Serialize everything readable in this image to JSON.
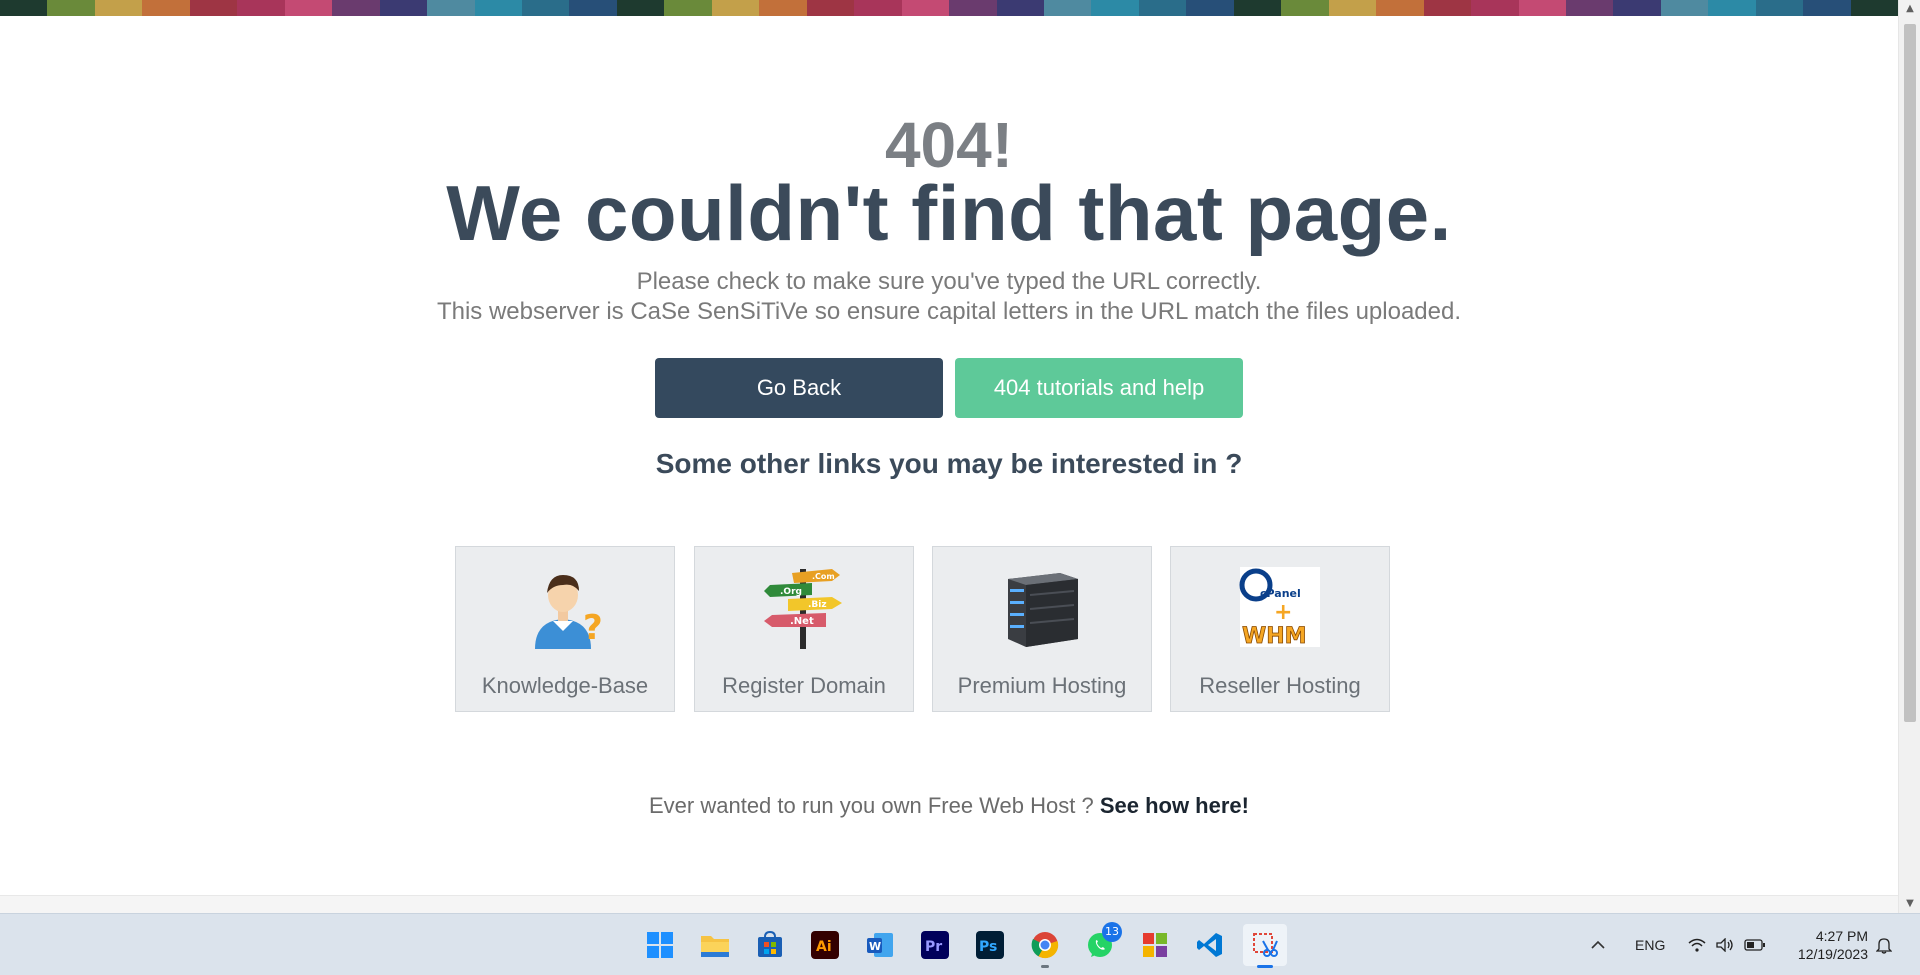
{
  "strip_colors": [
    "#1e3a2f",
    "#6a8a3a",
    "#c3a04a",
    "#c2703a",
    "#9e3544",
    "#a8355a",
    "#c44a73",
    "#6a3b6e",
    "#3b3a72",
    "#4f8aa0",
    "#2c8aa6",
    "#2a6d8a",
    "#274f78",
    "#1e3a2f",
    "#6a8a3a",
    "#c3a04a",
    "#c2703a",
    "#9e3544",
    "#a8355a",
    "#c44a73",
    "#6a3b6e",
    "#3b3a72",
    "#4f8aa0",
    "#2c8aa6",
    "#2a6d8a",
    "#274f78",
    "#1e3a2f",
    "#6a8a3a",
    "#c3a04a",
    "#c2703a",
    "#9e3544",
    "#a8355a",
    "#c44a73",
    "#6a3b6e",
    "#3b3a72",
    "#4f8aa0",
    "#2c8aa6",
    "#2a6d8a",
    "#274f78",
    "#1e3a2f"
  ],
  "error": {
    "code": "404!",
    "headline": "We couldn't find that page.",
    "line1": "Please check to make sure you've typed the URL correctly.",
    "line2": "This webserver is CaSe SenSiTiVe so ensure capital letters in the URL match the files uploaded."
  },
  "buttons": {
    "back": "Go Back",
    "help": "404 tutorials and help"
  },
  "other_links_heading": "Some other links you may be interested in ?",
  "cards": [
    {
      "label": "Knowledge-Base",
      "icon": "knowledge-base-icon"
    },
    {
      "label": "Register Domain",
      "icon": "domain-signpost-icon"
    },
    {
      "label": "Premium Hosting",
      "icon": "server-icon"
    },
    {
      "label": "Reseller Hosting",
      "icon": "cpanel-whm-icon"
    }
  ],
  "cpanel_logo_text": {
    "top": "cPanel",
    "bottom": "WHM"
  },
  "domain_signs": [
    ".Com",
    ".Org",
    ".Biz",
    ".Net"
  ],
  "footer": {
    "prefix": "Ever wanted to run you own Free Web Host ? ",
    "link": "See how here!"
  },
  "taskbar": {
    "apps": [
      "start-icon",
      "file-explorer-icon",
      "store-icon",
      "illustrator-icon",
      "word-icon",
      "premiere-icon",
      "photoshop-icon",
      "chrome-icon",
      "whatsapp-icon",
      "office-icon",
      "vscode-icon",
      "snipping-tool-icon"
    ],
    "whatsapp_badge": "13",
    "lang": "ENG",
    "time": "4:27 PM",
    "date": "12/19/2023"
  },
  "colors": {
    "go_back": "#34495e",
    "help": "#5ec999",
    "headline": "#3b4a5a"
  }
}
